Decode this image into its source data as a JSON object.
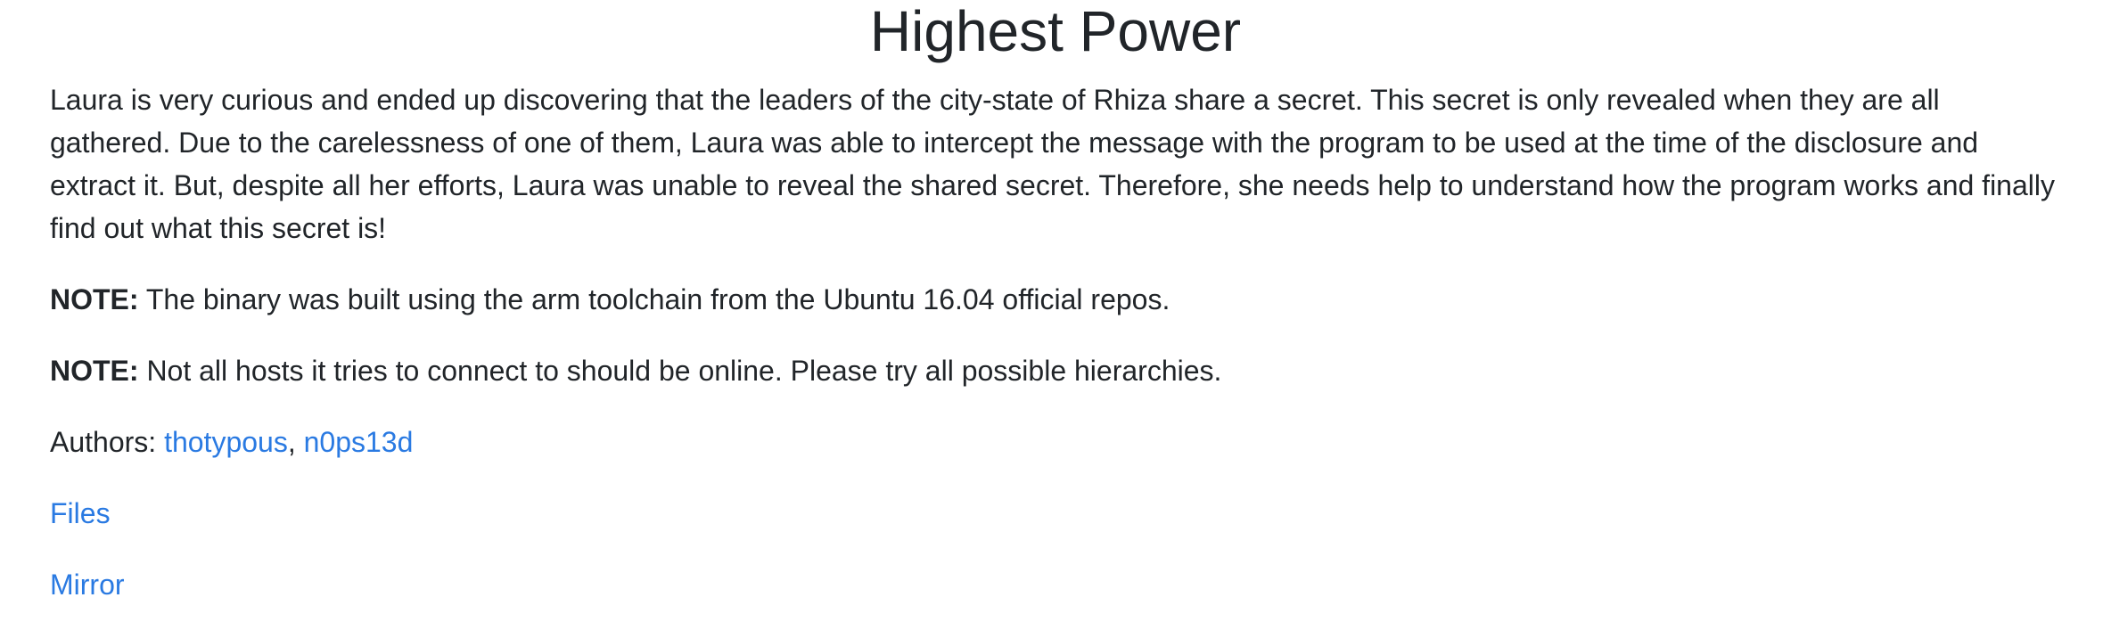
{
  "challenge": {
    "title": "Highest Power",
    "description": "Laura is very curious and ended up discovering that the leaders of the city-state of Rhiza share a secret. This secret is only revealed when they are all gathered. Due to the carelessness of one of them, Laura was able to intercept the message with the program to be used at the time of the disclosure and extract it. But, despite all her efforts, Laura was unable to reveal the shared secret. Therefore, she needs help to understand how the program works and finally find out what this secret is!",
    "note_label": "NOTE:",
    "note1_text": " The binary was built using the arm toolchain from the Ubuntu 16.04 official repos.",
    "note2_text": " Not all hosts it tries to connect to should be online. Please try all possible hierarchies.",
    "authors_label": "Authors: ",
    "authors": [
      "thotypous",
      "n0ps13d"
    ],
    "author_separator": ", ",
    "files_label": "Files",
    "mirror_label": "Mirror"
  },
  "colors": {
    "text": "#212529",
    "link": "#2a7ae2",
    "background": "#ffffff"
  }
}
